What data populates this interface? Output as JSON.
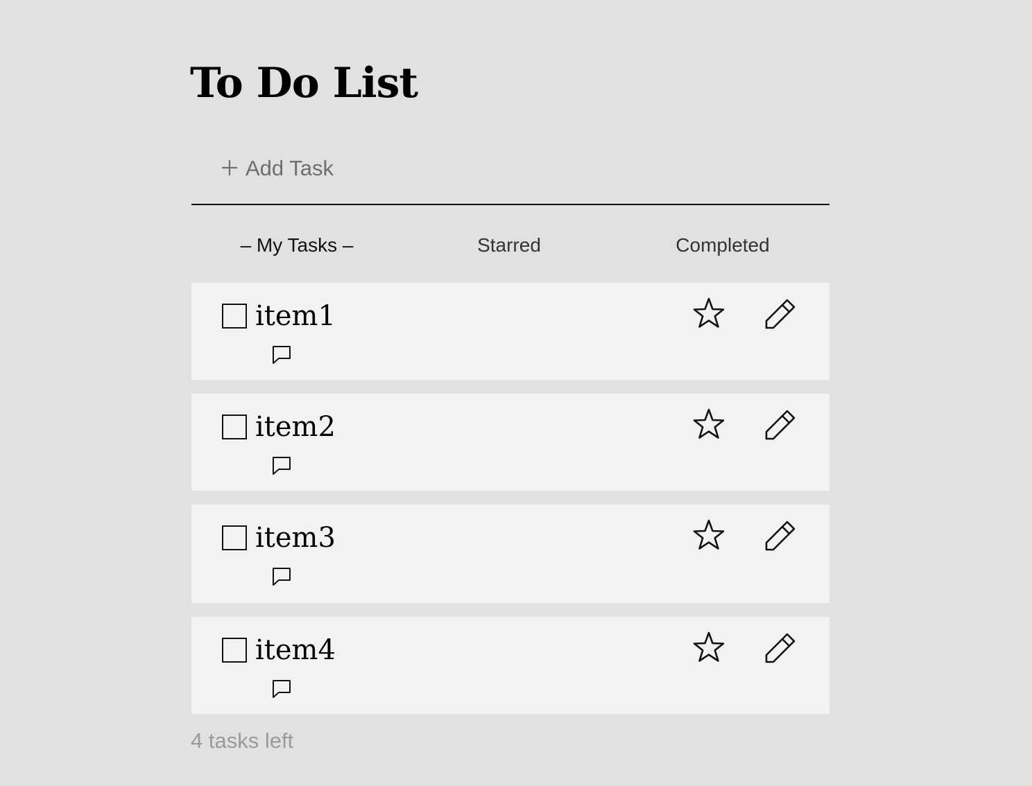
{
  "page": {
    "title": "To Do List"
  },
  "add_task": {
    "placeholder": "Add Task",
    "icon": "plus-icon"
  },
  "tabs": [
    {
      "label": "– My Tasks –",
      "active": true
    },
    {
      "label": "Starred",
      "active": false
    },
    {
      "label": "Completed",
      "active": false
    }
  ],
  "tasks": [
    {
      "name": "item1",
      "checked": false,
      "starred": false
    },
    {
      "name": "item2",
      "checked": false,
      "starred": false
    },
    {
      "name": "item3",
      "checked": false,
      "starred": false
    },
    {
      "name": "item4",
      "checked": false,
      "starred": false
    }
  ],
  "footer": {
    "count_label": "4 tasks left"
  },
  "colors": {
    "background": "#e1e1e1",
    "card": "#f2f2f2",
    "text": "#000000",
    "muted": "#9a9a9a"
  }
}
